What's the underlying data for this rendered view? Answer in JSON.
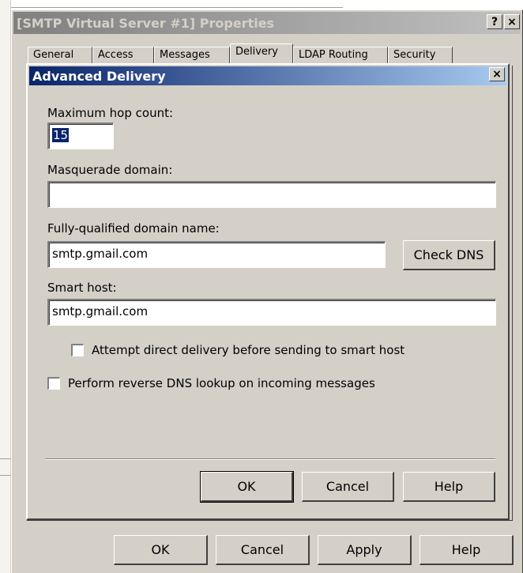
{
  "outer_window": {
    "title": "[SMTP Virtual Server #1] Properties",
    "help_glyph": "?",
    "close_glyph": "×",
    "tabs": [
      {
        "label": "General"
      },
      {
        "label": "Access"
      },
      {
        "label": "Messages"
      },
      {
        "label": "Delivery"
      },
      {
        "label": "LDAP Routing"
      },
      {
        "label": "Security"
      }
    ],
    "buttons": {
      "ok": "OK",
      "cancel": "Cancel",
      "apply": "Apply",
      "help": "Help"
    }
  },
  "dialog": {
    "title": "Advanced Delivery",
    "close_glyph": "×",
    "max_hop": {
      "label": "Maximum hop count:",
      "value": "15"
    },
    "masquerade": {
      "label": "Masquerade domain:",
      "value": ""
    },
    "fqdn": {
      "label": "Fully-qualified domain name:",
      "value": "smtp.gmail.com"
    },
    "check_dns_label": "Check DNS",
    "smart_host": {
      "label": "Smart host:",
      "value": "smtp.gmail.com"
    },
    "attempt_direct": {
      "label": "Attempt direct delivery before sending to smart host",
      "checked": false
    },
    "reverse_dns": {
      "label": "Perform reverse DNS lookup on incoming messages",
      "checked": false
    },
    "buttons": {
      "ok": "OK",
      "cancel": "Cancel",
      "help": "Help"
    }
  }
}
